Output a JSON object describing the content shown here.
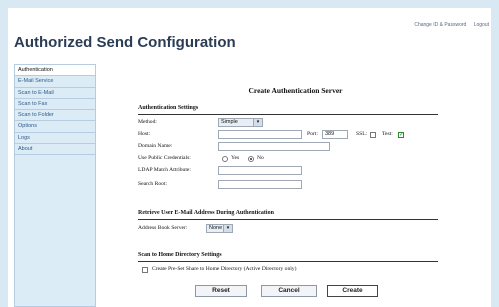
{
  "header": {
    "links": [
      "Change ID & Password",
      "Logout"
    ],
    "title": "Authorized Send Configuration"
  },
  "sidebar": {
    "items": [
      {
        "label": "Authentication",
        "active": true
      },
      {
        "label": "E-Mail Service",
        "active": false
      },
      {
        "label": "Scan to E-Mail",
        "active": false
      },
      {
        "label": "Scan to Fax",
        "active": false
      },
      {
        "label": "Scan to Folder",
        "active": false
      },
      {
        "label": "Options",
        "active": false
      },
      {
        "label": "Logs",
        "active": false
      },
      {
        "label": "About",
        "active": false
      }
    ]
  },
  "form": {
    "title": "Create Authentication Server",
    "auth_section": "Authentication Settings",
    "method_label": "Method:",
    "method_value": "Simple",
    "host_label": "Host:",
    "host_value": "",
    "port_label": "Port:",
    "port_value": "389",
    "ssl_label": "SSL:",
    "test_label": "Test:",
    "domain_label": "Domain Name:",
    "domain_value": "",
    "public_label": "Use Public Credentials:",
    "yes_label": "Yes",
    "no_label": "No",
    "ldap_label": "LDAP Match Attribute:",
    "ldap_value": "",
    "search_label": "Search Root:",
    "search_value": "",
    "retrieve_section": "Retrieve User E-Mail Address During Authentication",
    "addressbook_label": "Address Book Server:",
    "addressbook_value": "None",
    "home_section": "Scan to Home Directory Settings",
    "preset_label": "Create Pre-Set Share to Home Directory (Active Directory only)"
  },
  "buttons": {
    "reset": "Reset",
    "cancel": "Cancel",
    "create": "Create"
  },
  "state": {
    "ssl_checked": false,
    "test_checked": true,
    "public_credentials": "No",
    "preset_checked": false
  }
}
